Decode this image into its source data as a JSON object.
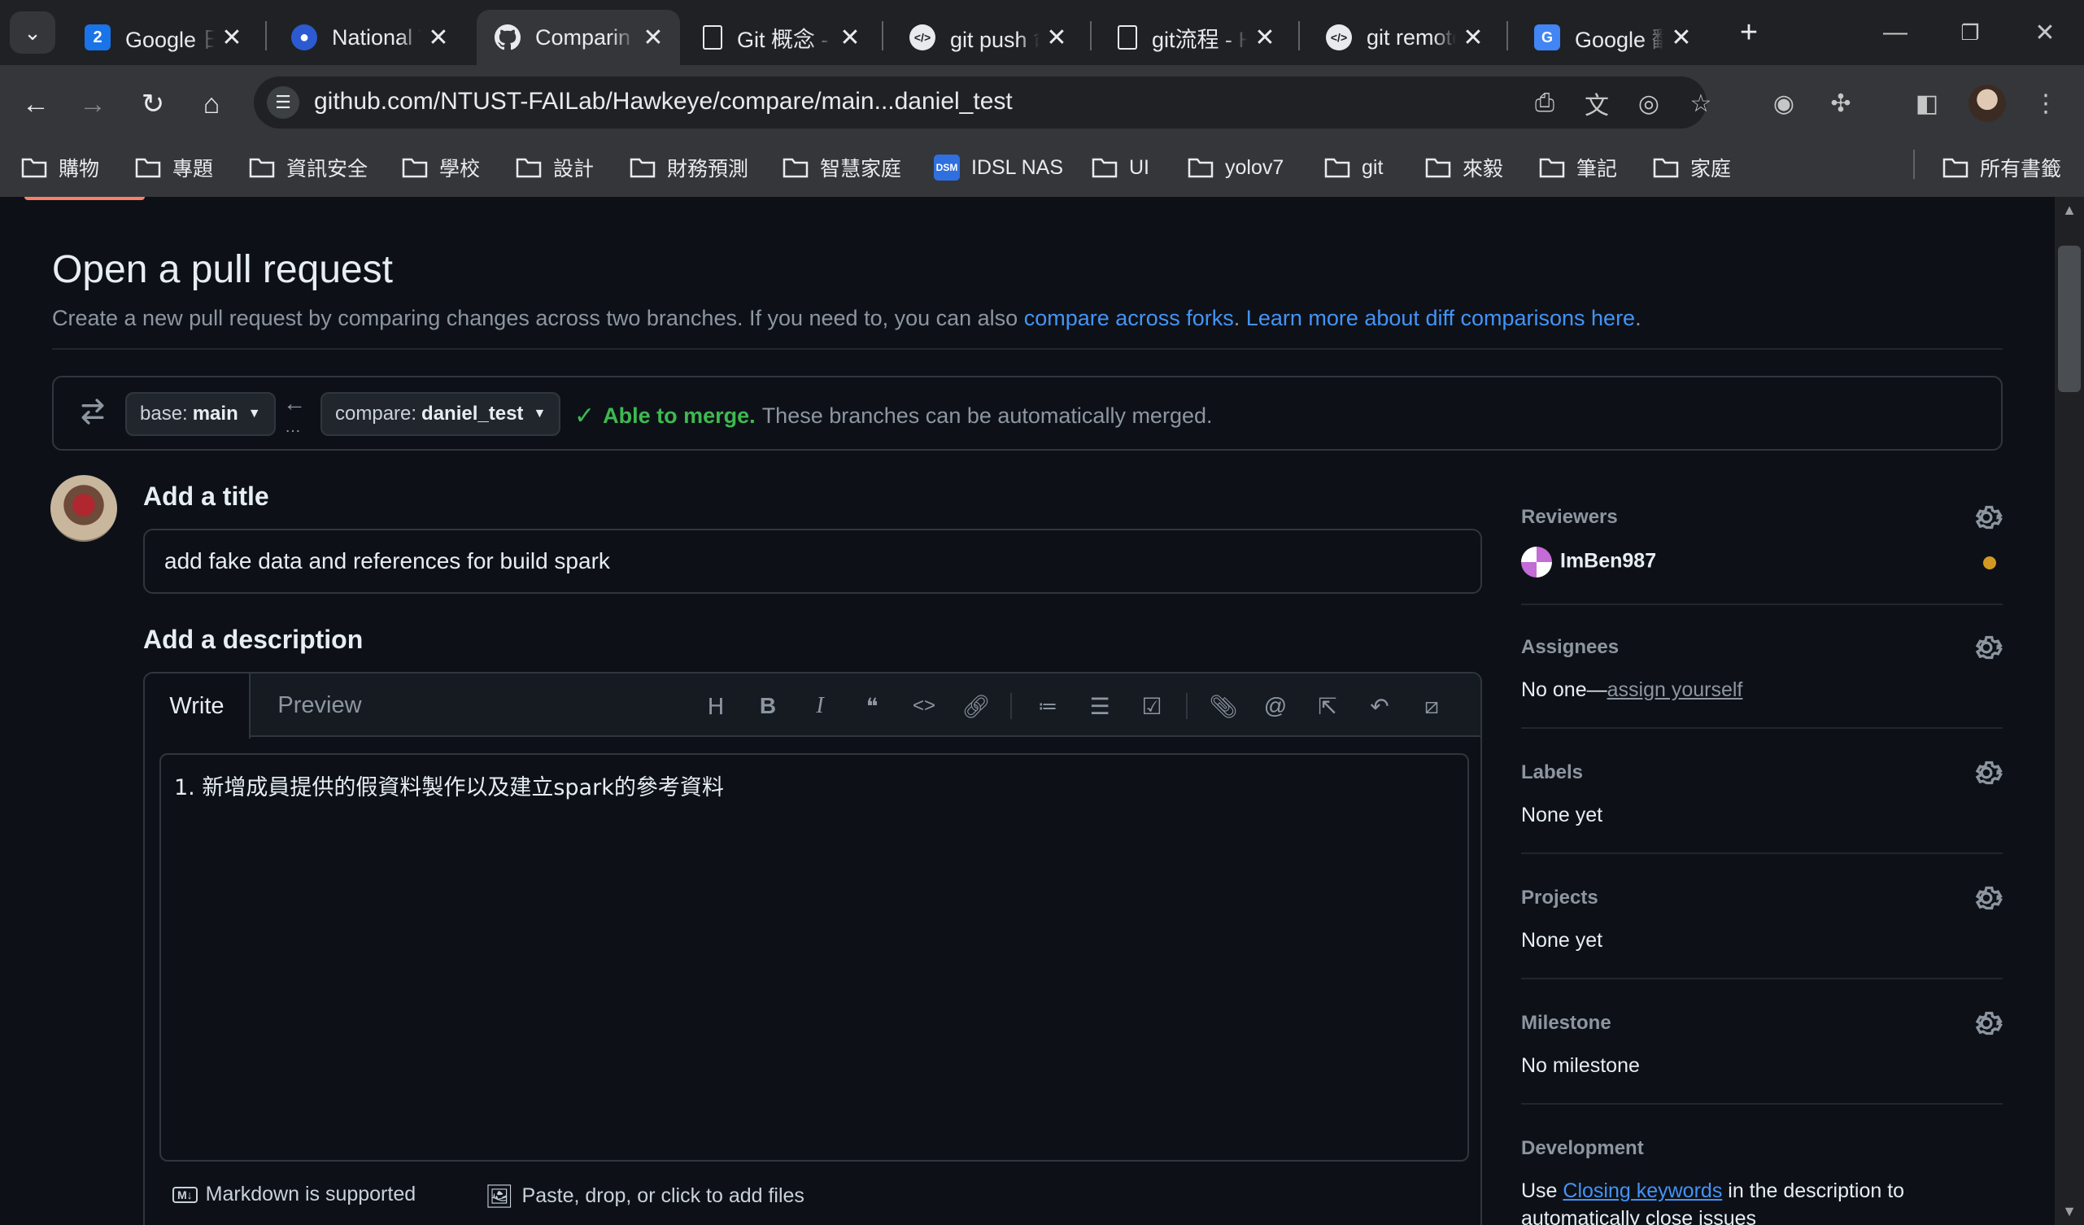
{
  "browser": {
    "tabs": [
      {
        "title": "Google 日",
        "icon": "google-calendar-icon",
        "active": false
      },
      {
        "title": "National T",
        "icon": "ntust-icon",
        "active": false
      },
      {
        "title": "Comparin",
        "icon": "github-icon",
        "active": true
      },
      {
        "title": "Git 概念 -",
        "icon": "document-icon",
        "active": false
      },
      {
        "title": "git push 命",
        "icon": "chatgpt-icon",
        "active": false
      },
      {
        "title": "git流程 - H",
        "icon": "document-icon",
        "active": false
      },
      {
        "title": "git remote",
        "icon": "chatgpt-icon",
        "active": false
      },
      {
        "title": "Google 翻",
        "icon": "google-translate-icon",
        "active": false
      }
    ],
    "url": "github.com/NTUST-FAILab/Hawkeye/compare/main...daniel_test",
    "bookmarks": [
      "購物",
      "專題",
      "資訊安全",
      "學校",
      "設計",
      "財務預測",
      "智慧家庭",
      "IDSL NAS",
      "UI",
      "yolov7",
      "git",
      "來毅",
      "筆記",
      "家庭"
    ],
    "all_bookmarks": "所有書籤",
    "dsm_badge": "DSM"
  },
  "page": {
    "title": "Open a pull request",
    "subtitle_prefix": "Create a new pull request by comparing changes across two branches. If you need to, you can also ",
    "subtitle_link1": "compare across forks",
    "subtitle_sep": ". ",
    "subtitle_link2": "Learn more about diff comparisons here",
    "subtitle_end": ".",
    "base_label": "base:",
    "base_value": "main",
    "compare_label": "compare:",
    "compare_value": "daniel_test",
    "merge_ok": "Able to merge.",
    "merge_text": "These branches can be automatically merged.",
    "add_title_heading": "Add a title",
    "title_value": "add fake data and references for build spark",
    "add_desc_heading": "Add a description",
    "editor_tab_write": "Write",
    "editor_tab_preview": "Preview",
    "description_value": "1. 新增成員提供的假資料製作以及建立spark的參考資料",
    "markdown_note": "Markdown is supported",
    "attach_note": "Paste, drop, or click to add files"
  },
  "sidebar": {
    "reviewers_title": "Reviewers",
    "reviewer_name": "ImBen987",
    "assignees_title": "Assignees",
    "assignees_prefix": "No one—",
    "assignees_link": "assign yourself",
    "labels_title": "Labels",
    "labels_value": "None yet",
    "projects_title": "Projects",
    "projects_value": "None yet",
    "milestone_title": "Milestone",
    "milestone_value": "No milestone",
    "development_title": "Development",
    "development_prefix": "Use ",
    "development_link": "Closing keywords",
    "development_suffix": " in the description to",
    "development_line2": "automatically close issues"
  },
  "colors": {
    "accent_blue": "#4493f8",
    "merge_green": "#3fb950",
    "reviewer_pending": "#d29922",
    "page_bg": "#0d1117"
  }
}
